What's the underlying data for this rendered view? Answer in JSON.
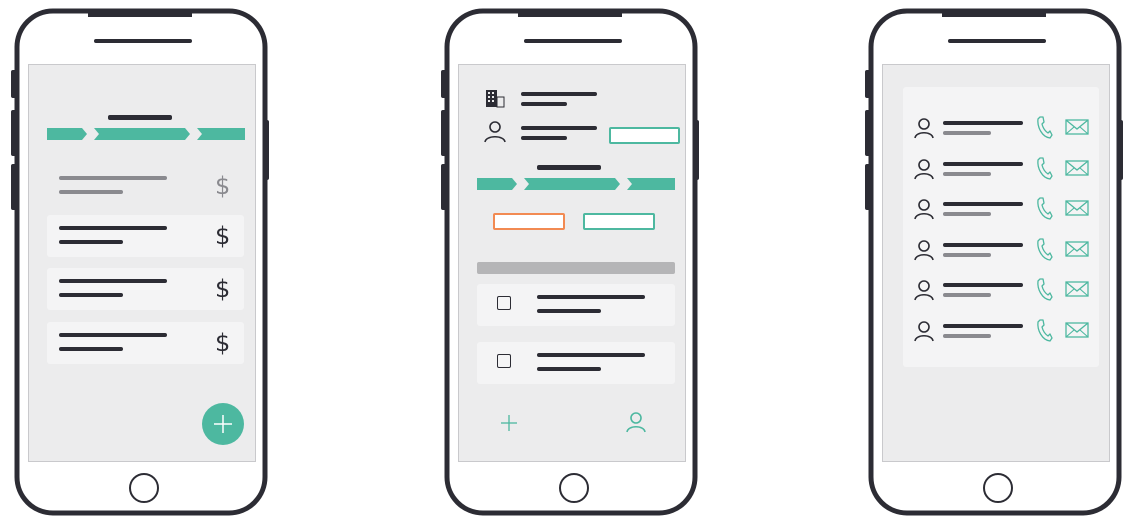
{
  "colors": {
    "accent": "#4db8a0",
    "danger_outline": "#f28a52",
    "frame": "#2c2c34",
    "screen": "#ececed",
    "text_dark": "#2c2c34",
    "text_muted": "#8a8a8f"
  },
  "phone1": {
    "rows": [
      {
        "currency": "$",
        "state": "muted"
      },
      {
        "currency": "$",
        "state": "active"
      },
      {
        "currency": "$",
        "state": "active"
      },
      {
        "currency": "$",
        "state": "active"
      }
    ],
    "fab_icon": "plus-icon"
  },
  "phone2": {
    "header_icons": [
      "building-icon",
      "user-icon"
    ],
    "tasks": [
      {
        "checkbox": "unchecked"
      },
      {
        "checkbox": "unchecked"
      }
    ],
    "bottom_icons": [
      "plus-icon",
      "user-icon"
    ]
  },
  "phone3": {
    "contacts": [
      {
        "icons": [
          "user-icon",
          "phone-icon",
          "mail-icon"
        ]
      },
      {
        "icons": [
          "user-icon",
          "phone-icon",
          "mail-icon"
        ]
      },
      {
        "icons": [
          "user-icon",
          "phone-icon",
          "mail-icon"
        ]
      },
      {
        "icons": [
          "user-icon",
          "phone-icon",
          "mail-icon"
        ]
      },
      {
        "icons": [
          "user-icon",
          "phone-icon",
          "mail-icon"
        ]
      },
      {
        "icons": [
          "user-icon",
          "phone-icon",
          "mail-icon"
        ]
      }
    ]
  }
}
